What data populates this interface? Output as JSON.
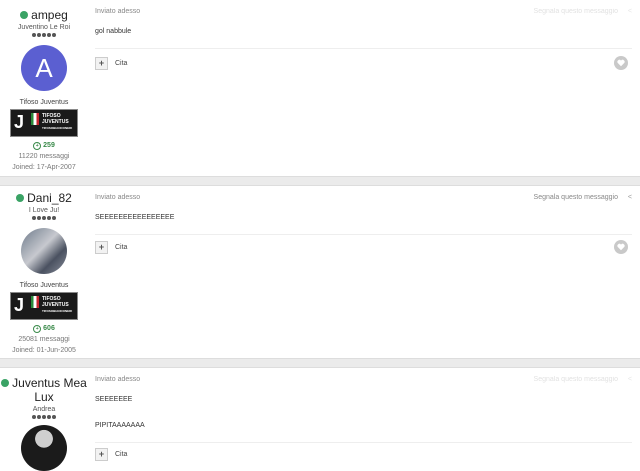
{
  "posts": [
    {
      "username": "ampeg",
      "subtitle": "Juventino Le Roi",
      "avatar_letter": "A",
      "group": "Tifoso Juventus",
      "badge_text": [
        "TIFOSO",
        "JUVENTUS",
        "TIFOSOBIANCONERI"
      ],
      "reputation": "259",
      "posts_count": "11220 messaggi",
      "joined": "Joined: 17-Apr-2007",
      "sent_label": "Inviato adesso",
      "report_label": "Segnala questo messaggio",
      "content": [
        "gol nabbule"
      ],
      "quote_label": "Cita"
    },
    {
      "username": "Dani_82",
      "subtitle": "I Love Ju!",
      "group": "Tifoso Juventus",
      "badge_text": [
        "TIFOSO",
        "JUVENTUS",
        "TIFOSOBIANCONERI"
      ],
      "reputation": "606",
      "posts_count": "25081 messaggi",
      "joined": "Joined: 01-Jun-2005",
      "sent_label": "Inviato adesso",
      "report_label": "Segnala questo messaggio",
      "content": [
        "SEEEEEEEEEEEEEEEE"
      ],
      "quote_label": "Cita"
    },
    {
      "username": "Juventus Mea Lux",
      "subtitle": "Andrea",
      "sent_label": "Inviato adesso",
      "report_label": "Segnala questo messaggio",
      "content": [
        "SEEEEEEE",
        "PIPITAAAAAAA"
      ],
      "quote_label": "Cita"
    }
  ],
  "icons": {
    "online": "online-dot",
    "share": "share-icon",
    "like": "heart-icon",
    "quote": "plus-icon"
  }
}
